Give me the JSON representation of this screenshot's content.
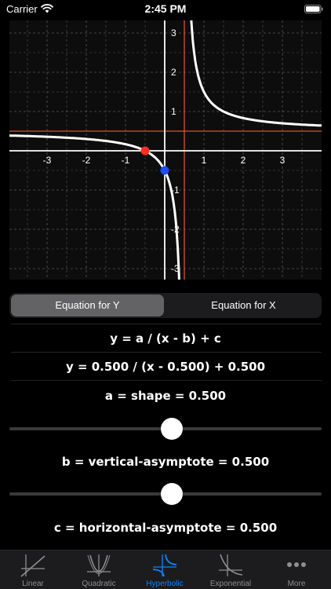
{
  "status": {
    "carrier": "Carrier",
    "time": "2:45 PM"
  },
  "graph": {
    "x_ticks": [
      "-3",
      "-2",
      "-1",
      "1",
      "2",
      "3"
    ],
    "y_ticks": [
      "3",
      "2",
      "1",
      "-1",
      "-2",
      "-3"
    ],
    "params": {
      "a": 0.5,
      "b": 0.5,
      "c": 0.5
    },
    "colors": {
      "curve": "#ffffff",
      "asymptote": "#e0531f",
      "x_intercept_point": "#ff2d1f",
      "y_intercept_point": "#1a4dff",
      "grid": "#555555",
      "axis": "#ffffff"
    }
  },
  "segmented": {
    "option_y": "Equation for Y",
    "option_x": "Equation for X",
    "selected": "Equation for Y"
  },
  "equation": {
    "general": "y = a / (x - b) + c",
    "current": "y = 0.500 / (x - 0.500) + 0.500",
    "a_label": "a = shape = 0.500",
    "b_label": "b = vertical-asymptote = 0.500",
    "c_label": "c = horizontal-asymptote = 0.500"
  },
  "sliders": {
    "a_fraction": 0.52,
    "b_fraction": 0.52
  },
  "tabs": [
    {
      "label": "Linear",
      "icon": "linear-graph-icon"
    },
    {
      "label": "Quadratic",
      "icon": "parabola-icon"
    },
    {
      "label": "Hyperbolic",
      "icon": "hyperbola-icon"
    },
    {
      "label": "Exponential",
      "icon": "exponential-icon"
    },
    {
      "label": "More",
      "icon": "more-dots-icon"
    }
  ],
  "active_tab": "Hyperbolic"
}
